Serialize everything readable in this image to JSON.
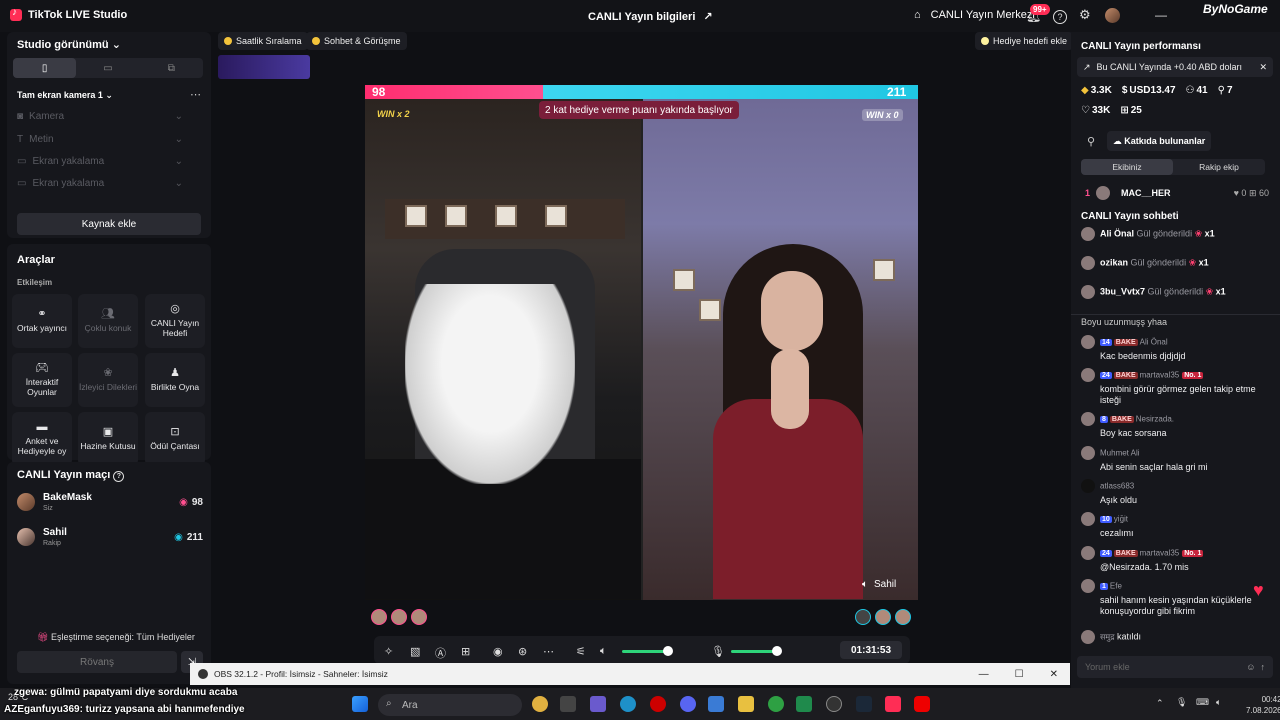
{
  "app": {
    "title": "TikTok LIVE Studio",
    "center_title": "CANLI Yayın bilgileri",
    "center_link": "CANLI Yayın Merkezi",
    "notif_count": "99+",
    "brand": "ByNoGame"
  },
  "studio": {
    "title": "Studio görünümü",
    "scene": "Tam ekran kamera 1",
    "sources": [
      "Kamera",
      "Metin",
      "Ekran yakalama",
      "Ekran yakalama"
    ],
    "add_source": "Kaynak ekle"
  },
  "tools": {
    "title": "Araçlar",
    "section": "Etkileşim",
    "items": [
      {
        "label": "Ortak yayıncı",
        "icon": "link-icon"
      },
      {
        "label": "Çoklu konuk",
        "icon": "users-icon"
      },
      {
        "label": "CANLI Yayın Hedefi",
        "icon": "target-icon"
      },
      {
        "label": "İnteraktif Oyunlar",
        "icon": "gamepad-icon"
      },
      {
        "label": "İzleyici Dilekleri",
        "icon": "gift-icon"
      },
      {
        "label": "Birlikte Oyna",
        "icon": "person-icon"
      },
      {
        "label": "Anket ve Hediyeyle oy",
        "icon": "poll-icon"
      },
      {
        "label": "Hazine Kutusu",
        "icon": "treasure-icon"
      },
      {
        "label": "Ödül Çantası",
        "icon": "bag-icon"
      }
    ]
  },
  "match": {
    "title": "CANLI Yayın maçı",
    "players": [
      {
        "name": "BakeMask",
        "role": "Siz",
        "score": "98"
      },
      {
        "name": "Sahil",
        "role": "Rakip",
        "score": "211"
      }
    ],
    "pairing": "Eşleştirme seçeneği: Tüm Hediyeler",
    "rematch": "Rövanş"
  },
  "chips": {
    "hourly": "Saatlik Sıralama",
    "chat": "Sohbet & Görüşme",
    "goal": "Hediye hedefi ekle"
  },
  "battle": {
    "left_score": "98",
    "right_score": "211",
    "banner": "2 kat hediye verme puanı yakında başlıyor",
    "left_win": "WIN x 2",
    "right_win": "WIN x 0",
    "right_name": "Sahil",
    "timer": "01:31:53"
  },
  "performance": {
    "title": "CANLI Yayın performansı",
    "notice": "Bu CANLI Yayında +0.40 ABD doları",
    "stats1": [
      "3.3K",
      "USD13.47",
      "41",
      "7"
    ],
    "stats2": [
      "33K",
      "25"
    ],
    "contributors": "Katkıda bulunanlar",
    "tab_team": "Ekibiniz",
    "tab_rival": "Rakip ekip",
    "top_rank": "1",
    "top_name": "MAC__HER",
    "top_a": "0",
    "top_b": "60"
  },
  "chat": {
    "title": "CANLI Yayın sohbeti",
    "gifts": [
      {
        "name": "Ali Önal",
        "text": "Gül gönderildi",
        "count": "x1"
      },
      {
        "name": "ozikan",
        "text": "Gül gönderildi",
        "count": "x1"
      },
      {
        "name": "3bu_Vvtx7",
        "text": "Gül gönderildi",
        "count": "x1"
      }
    ],
    "partial": "Boyu uzunmuşş yhaa",
    "messages": [
      {
        "lvl": "14",
        "fan": "BAKE",
        "name": "Ali Önal",
        "text": "Kac bedenmis djdjdjd",
        "no1": ""
      },
      {
        "lvl": "24",
        "fan": "BAKE",
        "name": "martaval35",
        "text": "kombini görür görmez gelen takip etme isteği",
        "no1": "No. 1"
      },
      {
        "lvl": "8",
        "fan": "BAKE",
        "name": "Nesirzada.",
        "text": "Boy kac sorsana",
        "no1": ""
      },
      {
        "lvl": "",
        "fan": "",
        "name": "Muhmet Ali",
        "text": "Abi senin saçlar hala gri mi",
        "no1": ""
      },
      {
        "lvl": "",
        "fan": "",
        "name": "atlass683",
        "text": "Aşık oldu",
        "no1": ""
      },
      {
        "lvl": "10",
        "fan": "",
        "name": "yiğit",
        "text": "cezalımı",
        "no1": ""
      },
      {
        "lvl": "24",
        "fan": "BAKE",
        "name": "martaval35",
        "text": "@Nesirzada. 1.70 mis",
        "no1": "No. 1"
      },
      {
        "lvl": "1",
        "fan": "",
        "name": "Efe",
        "text": "sahil hanım kesin yaşından küçüklerle konuşuyordur gibi fikrim",
        "no1": ""
      }
    ],
    "joined_name": "समुद्र",
    "joined_text": "katıldı",
    "placeholder": "Yorum ekle"
  },
  "obs": {
    "title": "OBS 32.1.2 - Profil: İsimsiz - Sahneler: İsimsiz"
  },
  "overlay": {
    "line1": "zgewa: gülmü papatyami diye sordukmu acaba",
    "line2": "AZEganfuyu369: turizz yapsana abi hanımefendiye"
  },
  "taskbar": {
    "weather": "28°C",
    "search": "Ara",
    "time": "00:42",
    "date": "7.08.2026"
  },
  "colors": {
    "pink": "#ff2d6f",
    "cyan": "#20c7e3",
    "accent_green": "#2ed47a"
  }
}
